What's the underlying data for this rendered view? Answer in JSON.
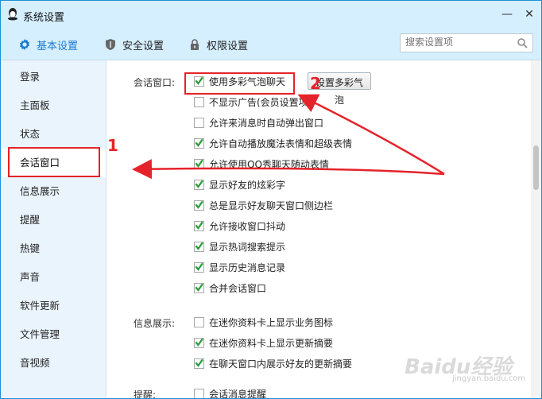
{
  "window": {
    "title": "系统设置",
    "minimize_label": "—",
    "close_label": "✕"
  },
  "tabs": [
    {
      "label": "基本设置",
      "icon": "gear-icon",
      "active": true
    },
    {
      "label": "安全设置",
      "icon": "shield-icon",
      "active": false
    },
    {
      "label": "权限设置",
      "icon": "lock-icon",
      "active": false
    }
  ],
  "search": {
    "placeholder": "搜索设置项"
  },
  "sidebar": {
    "items": [
      {
        "label": "登录"
      },
      {
        "label": "主面板"
      },
      {
        "label": "状态"
      },
      {
        "label": "会话窗口",
        "active": true
      },
      {
        "label": "信息展示"
      },
      {
        "label": "提醒"
      },
      {
        "label": "热键"
      },
      {
        "label": "声音"
      },
      {
        "label": "软件更新"
      },
      {
        "label": "文件管理"
      },
      {
        "label": "音视频"
      }
    ]
  },
  "sections": {
    "session": {
      "label": "会话窗口:",
      "set_bubble_button": "设置多彩气泡",
      "options": [
        {
          "label": "使用多彩气泡聊天",
          "checked": true
        },
        {
          "label": "不显示广告(会员设置项)",
          "checked": false
        },
        {
          "label": "允许来消息时自动弹出窗口",
          "checked": false
        },
        {
          "label": "允许自动播放魔法表情和超级表情",
          "checked": true
        },
        {
          "label": "允许使用QQ秀聊天随动表情",
          "checked": true
        },
        {
          "label": "显示好友的炫彩字",
          "checked": true
        },
        {
          "label": "总是显示好友聊天窗口侧边栏",
          "checked": true
        },
        {
          "label": "允许接收窗口抖动",
          "checked": true
        },
        {
          "label": "显示热词搜索提示",
          "checked": true
        },
        {
          "label": "显示历史消息记录",
          "checked": true
        },
        {
          "label": "合并会话窗口",
          "checked": true
        }
      ]
    },
    "info": {
      "label": "信息展示:",
      "options": [
        {
          "label": "在迷你资料卡上显示业务图标",
          "checked": false
        },
        {
          "label": "在迷你资料卡上显示更新摘要",
          "checked": true
        },
        {
          "label": "在聊天窗口内展示好友的更新摘要",
          "checked": true
        }
      ]
    },
    "reminder": {
      "label": "提醒:",
      "options": [
        {
          "label": "会话消息提醒",
          "checked": false
        }
      ]
    }
  },
  "annotations": {
    "num1": "1",
    "num2": "2",
    "color": "#e5232a"
  },
  "watermark": {
    "text": "Baidu经验",
    "sub": "jingyan.baidu.com"
  },
  "colors": {
    "accent": "#1c7bd0",
    "titlebar": "#d6efff",
    "sidebar": "#eaf4fc",
    "check": "#2c9e3d"
  }
}
